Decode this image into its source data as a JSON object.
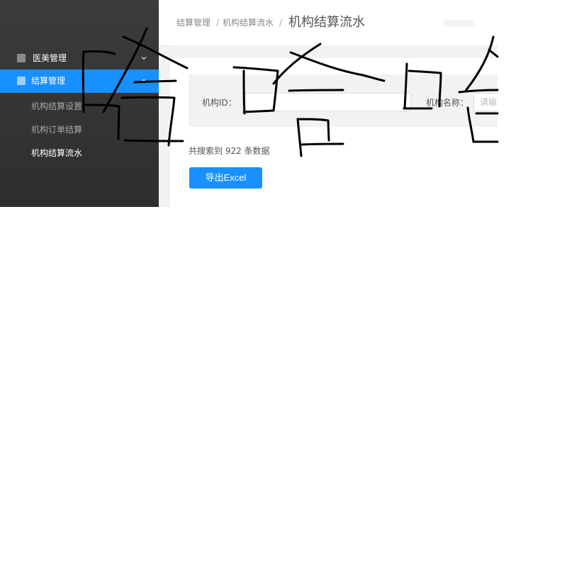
{
  "sidebar": {
    "menus": [
      {
        "label": "医美管理",
        "expanded": false,
        "active": false,
        "icon": "square-icon",
        "icon_color": "#8c8c8c"
      },
      {
        "label": "结算管理",
        "expanded": true,
        "active": true,
        "icon": "square-icon",
        "icon_color": "#9fd0ff"
      }
    ],
    "sub_items": [
      {
        "label": "机构结算设置",
        "color": "#a8a8a8"
      },
      {
        "label": "机构订单结算",
        "color": "#a8a8a8"
      },
      {
        "label": "机构结算流水",
        "color": "#ffffff"
      }
    ]
  },
  "breadcrumb": {
    "items": [
      "结算管理",
      "机构结算流水"
    ],
    "separator": "/",
    "current": "机构结算流水"
  },
  "search": {
    "org_id_label": "机构ID：",
    "org_id_value": "",
    "org_name_label": "机构名称：",
    "org_name_placeholder": "请输入"
  },
  "results": {
    "summary": "共搜索到 922 条数据"
  },
  "actions": {
    "export_label": "导出Excel"
  },
  "colors": {
    "primary": "#1890ff",
    "sidebar_bg": "#333333",
    "panel_bg": "#f2f2f2",
    "scribble": "#000000"
  }
}
